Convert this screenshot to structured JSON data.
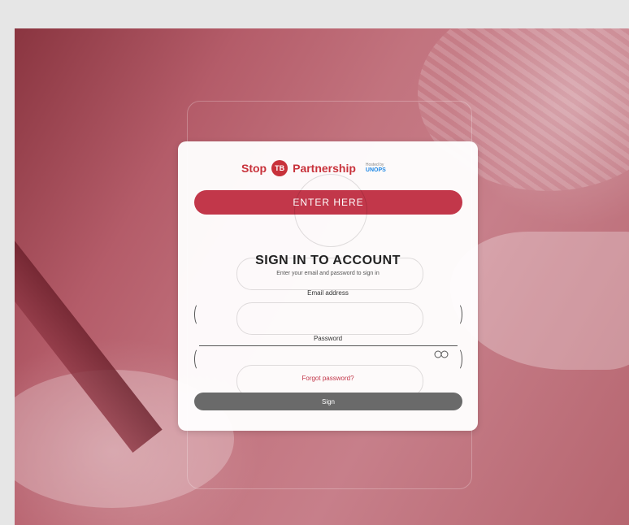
{
  "brand": {
    "stop_text": "Stop",
    "tb_text": "TB",
    "partnership_text": "Partnership",
    "hosted_by_label": "Hosted by",
    "hosted_by_org": "UNOPS",
    "accent_color": "#c8323b"
  },
  "enter_button": {
    "label": "ENTER HERE"
  },
  "signin": {
    "title": "SIGN IN TO ACCOUNT",
    "subtitle": "Enter your email and password to sign in"
  },
  "email_field": {
    "label": "Email address",
    "value": "",
    "placeholder": ""
  },
  "password_field": {
    "label": "Password",
    "value": "",
    "placeholder": "",
    "toggle_icon": "eye-icon"
  },
  "forgot_link": {
    "label": "Forgot password?"
  },
  "signin_button": {
    "label": "Sign"
  }
}
